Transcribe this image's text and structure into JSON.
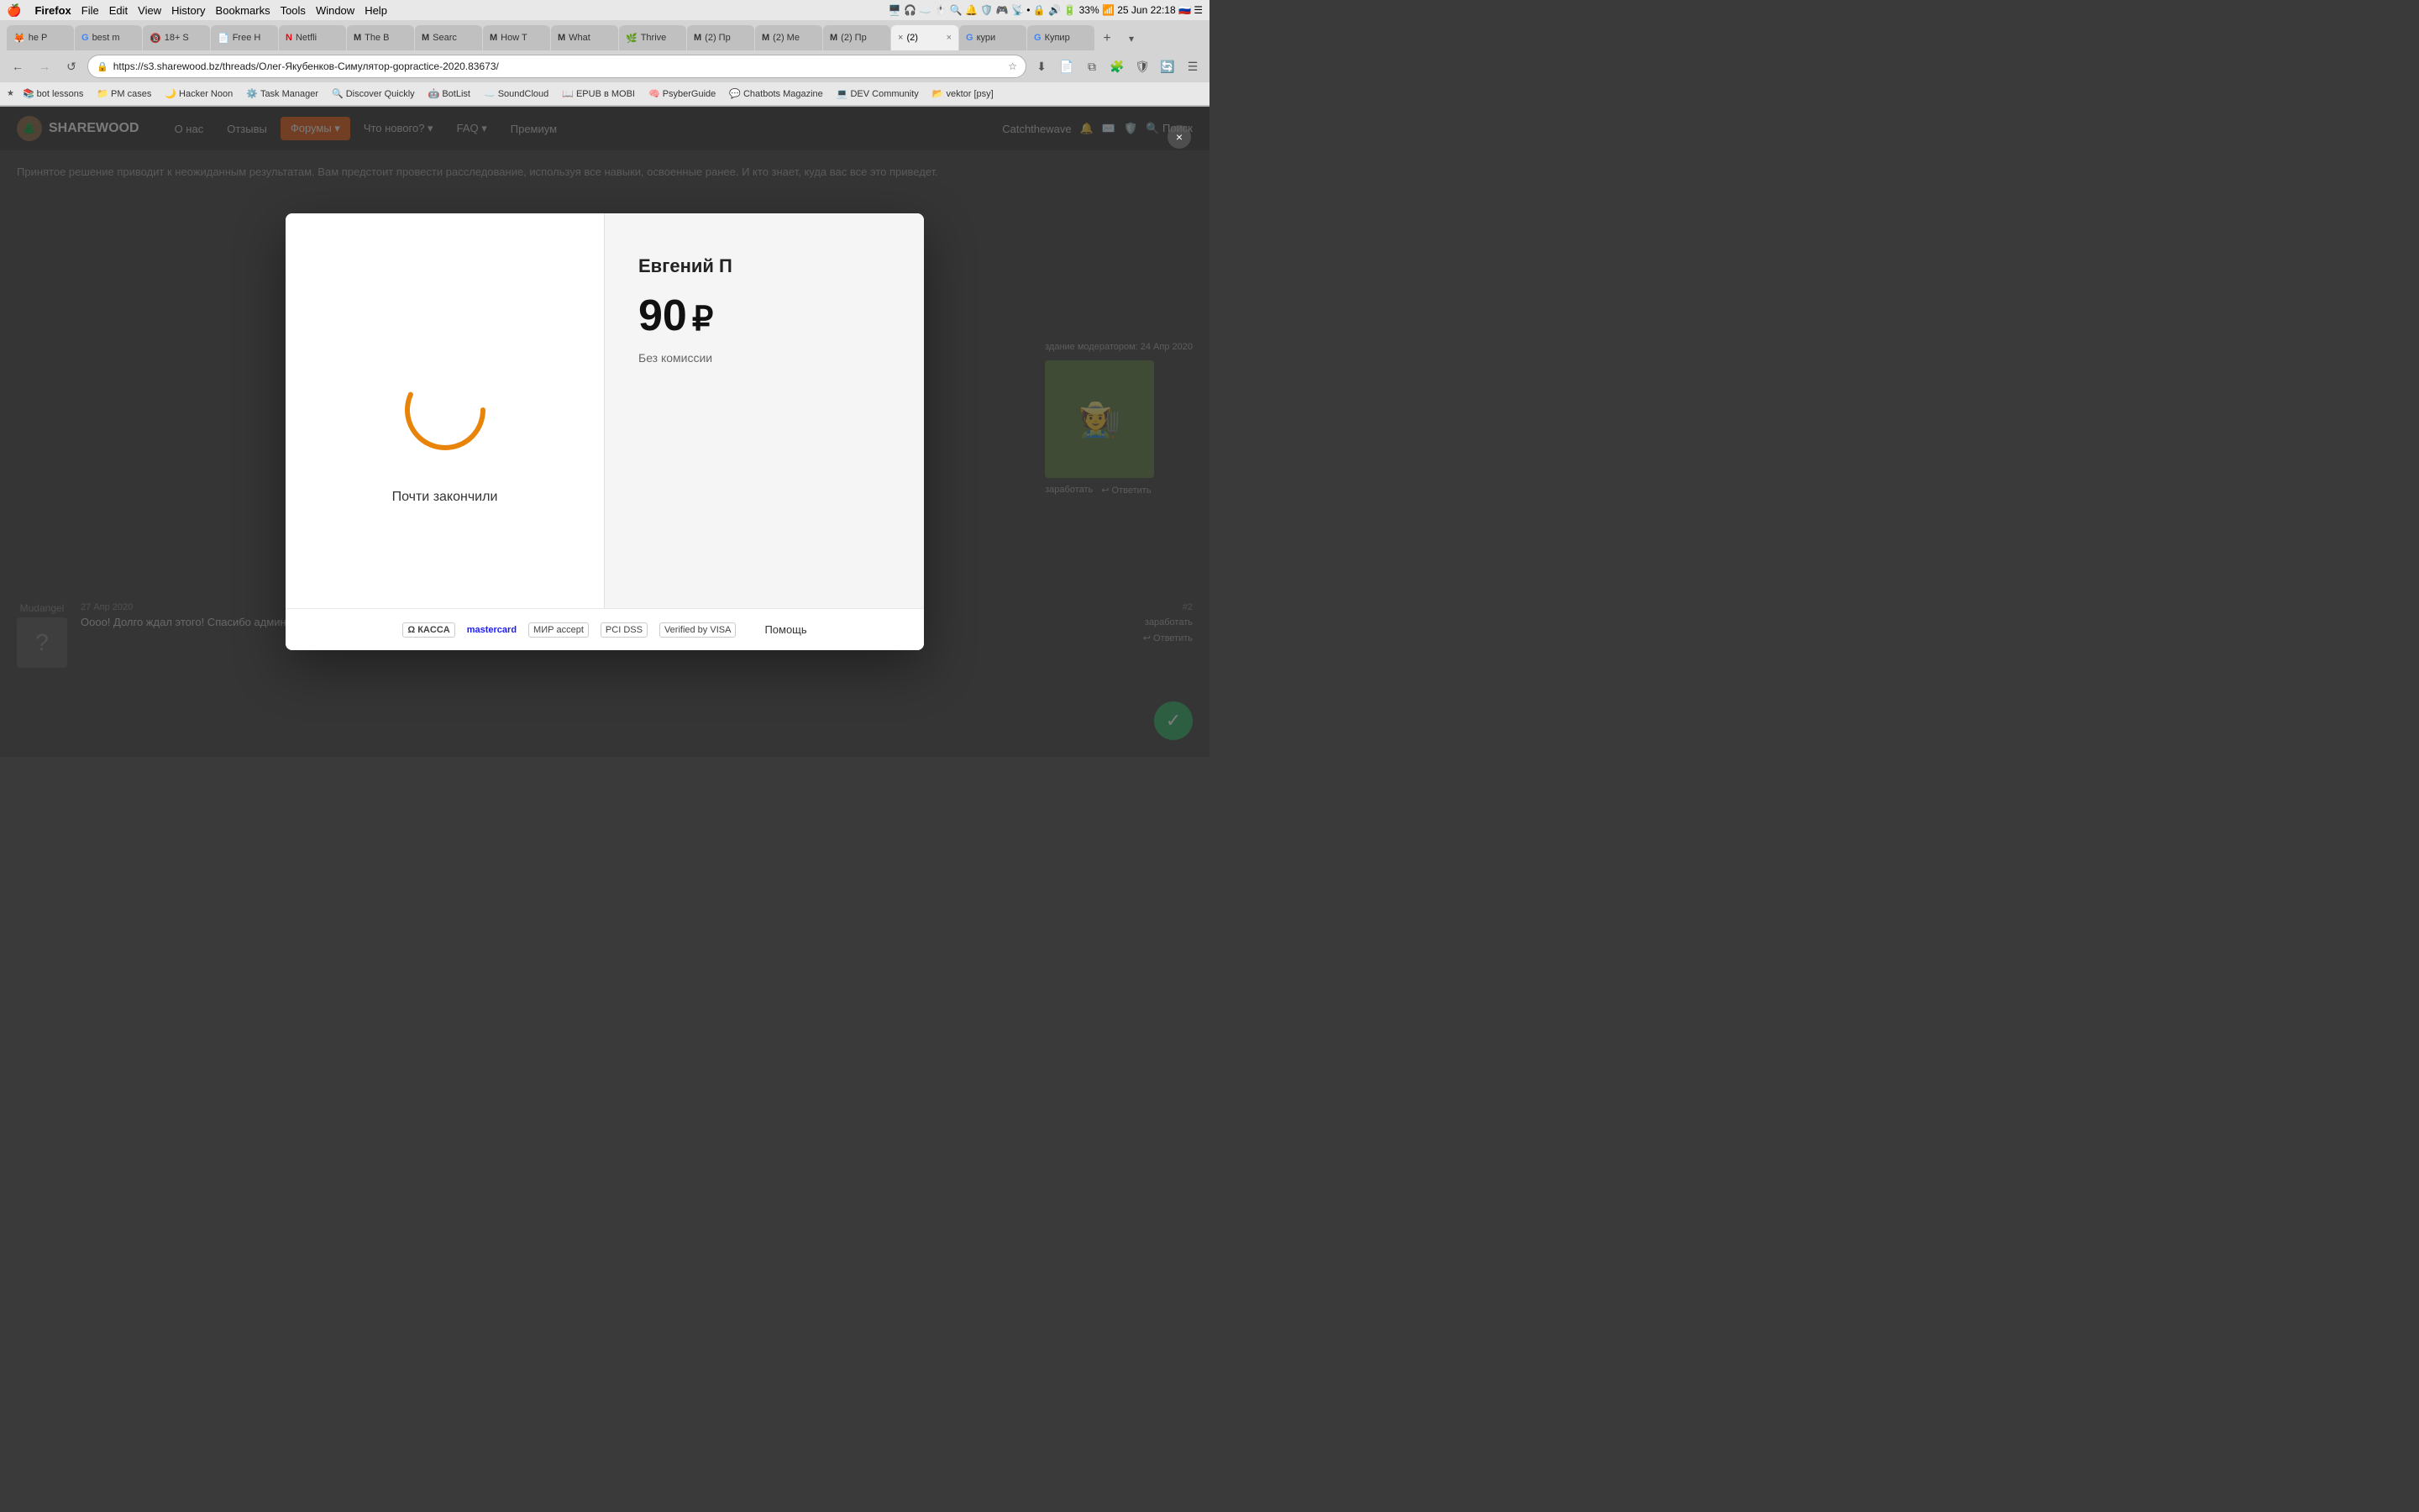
{
  "os": {
    "menubar": {
      "apple": "🍎",
      "menus": [
        "Firefox",
        "File",
        "Edit",
        "View",
        "History",
        "Bookmarks",
        "Tools",
        "Window",
        "Help"
      ],
      "right_info": "33% 🔋 📶 25 Jun 22:18"
    }
  },
  "browser": {
    "tabs": [
      {
        "id": "t1",
        "label": "he P",
        "favicon": "🦊",
        "active": false
      },
      {
        "id": "t2",
        "label": "best m",
        "favicon": "G",
        "active": false
      },
      {
        "id": "t3",
        "label": "18+ S",
        "favicon": "🔞",
        "active": false
      },
      {
        "id": "t4",
        "label": "Free H",
        "favicon": "📄",
        "active": false
      },
      {
        "id": "t5",
        "label": "Netfli",
        "favicon": "N",
        "active": false
      },
      {
        "id": "t6",
        "label": "The B",
        "favicon": "M",
        "active": false
      },
      {
        "id": "t7",
        "label": "Searc",
        "favicon": "M",
        "active": false
      },
      {
        "id": "t8",
        "label": "How T",
        "favicon": "M",
        "active": false
      },
      {
        "id": "t9",
        "label": "What",
        "favicon": "M",
        "active": false
      },
      {
        "id": "t10",
        "label": "Thrive",
        "favicon": "🌿",
        "active": false
      },
      {
        "id": "t11",
        "label": "(2) Пр",
        "favicon": "M",
        "active": false
      },
      {
        "id": "t12",
        "label": "(2) Me",
        "favicon": "M",
        "active": false
      },
      {
        "id": "t13",
        "label": "(2) Пр",
        "favicon": "M",
        "active": false
      },
      {
        "id": "t14",
        "label": "(2)",
        "favicon": "×",
        "active": true
      },
      {
        "id": "t15",
        "label": "кури",
        "favicon": "G",
        "active": false
      },
      {
        "id": "t16",
        "label": "Купир",
        "favicon": "G",
        "active": false
      }
    ],
    "address": "https://s3.sharewood.bz/threads/Олег-Якубенков-Симулятор-gopractice-2020.83673/",
    "bookmarks": [
      {
        "label": "bot lessons",
        "icon": "📚"
      },
      {
        "label": "PM cases",
        "icon": "📁"
      },
      {
        "label": "Hacker Noon",
        "icon": "🌙"
      },
      {
        "label": "Task Manager",
        "icon": "⚙️"
      },
      {
        "label": "Discover Quickly",
        "icon": "🔍"
      },
      {
        "label": "BotList",
        "icon": "🤖"
      },
      {
        "label": "SoundCloud",
        "icon": "☁️"
      },
      {
        "label": "EPUB в MOBI",
        "icon": "📖"
      },
      {
        "label": "PsyberGuide",
        "icon": "🧠"
      },
      {
        "label": "Chatbots Magazine",
        "icon": "💬"
      },
      {
        "label": "DEV Community",
        "icon": "💻"
      },
      {
        "label": "vektor [psy]",
        "icon": "📂"
      }
    ]
  },
  "forum": {
    "logo": "SHAREWOOD",
    "nav": [
      "О нас",
      "Отзывы",
      "Форумы",
      "Что нового?",
      "FAQ",
      "Премиум"
    ],
    "active_nav": "Форумы",
    "header_right": [
      "Catchthewave",
      "Поиск"
    ],
    "body_text": "Принятое решение приводит к неожиданным результатам. Вам предстоит провести расследование, используя все навыки, освоенные ранее.\nИ кто знает, куда вас все это приведет.",
    "right_sidebar_date": "здание модератором: 24 Апр 2020",
    "bottom_user": "Mudangel",
    "bottom_date": "27 Апр 2020",
    "bottom_post_text": "Оооо! Долго ждал этого! Спасибо админам!!!",
    "post_number": "#2",
    "post_actions": [
      "заработать",
      "Ответить"
    ]
  },
  "modal": {
    "loading_text": "Почти закончили",
    "recipient": "Евгений П",
    "amount": "90",
    "currency": "₽",
    "no_commission": "Без комиссии",
    "payment_logos": [
      "КACCA",
      "mastercard",
      "МИР",
      "PCI DSS",
      "Verified by VISA"
    ],
    "help_label": "Помощь"
  }
}
